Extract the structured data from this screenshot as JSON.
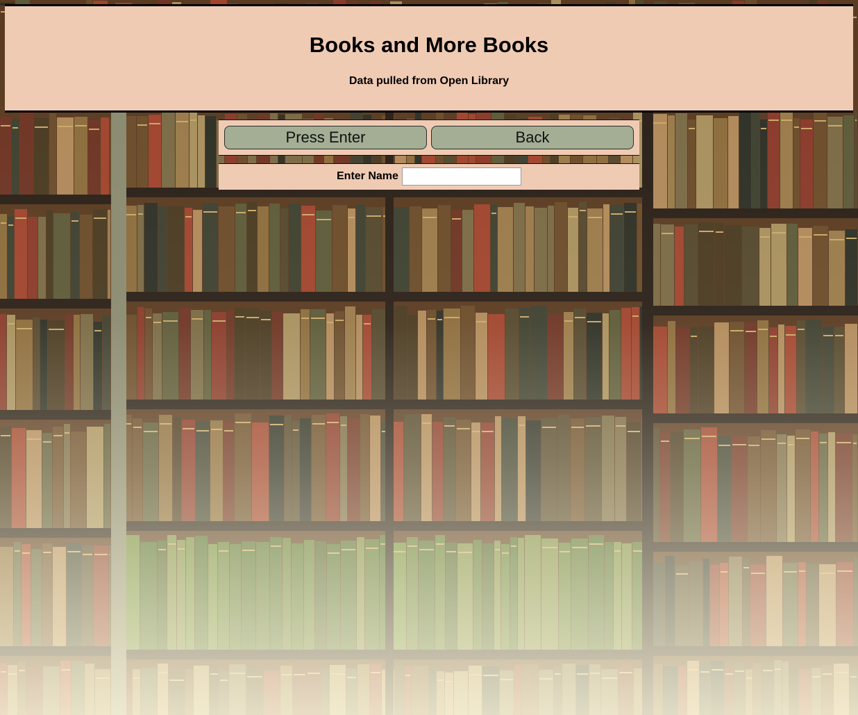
{
  "header": {
    "title": "Books and More Books",
    "subtitle": "Data pulled from Open Library"
  },
  "actions": {
    "press_enter_label": "Press Enter",
    "back_label": "Back"
  },
  "form": {
    "name_label": "Enter Name",
    "name_value": "",
    "name_placeholder": ""
  },
  "colors": {
    "panel": "#f0cbb4",
    "button": "#a3ae94",
    "border": "#000000"
  }
}
